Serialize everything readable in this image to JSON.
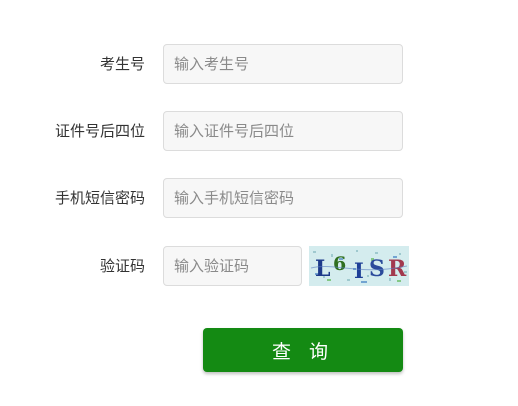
{
  "form": {
    "exam_number": {
      "label": "考生号",
      "placeholder": "输入考生号",
      "value": ""
    },
    "id_last_four": {
      "label": "证件号后四位",
      "placeholder": "输入证件号后四位",
      "value": ""
    },
    "sms_password": {
      "label": "手机短信密码",
      "placeholder": "输入手机短信密码",
      "value": ""
    },
    "captcha": {
      "label": "验证码",
      "placeholder": "输入验证码",
      "value": "",
      "image_text": "L6 ISR"
    },
    "submit_label": "查 询"
  },
  "colors": {
    "button": "#148a13",
    "field_background": "#f7f7f7",
    "field_border": "#dcdcdc",
    "captcha_background": "#cfe9ec"
  }
}
